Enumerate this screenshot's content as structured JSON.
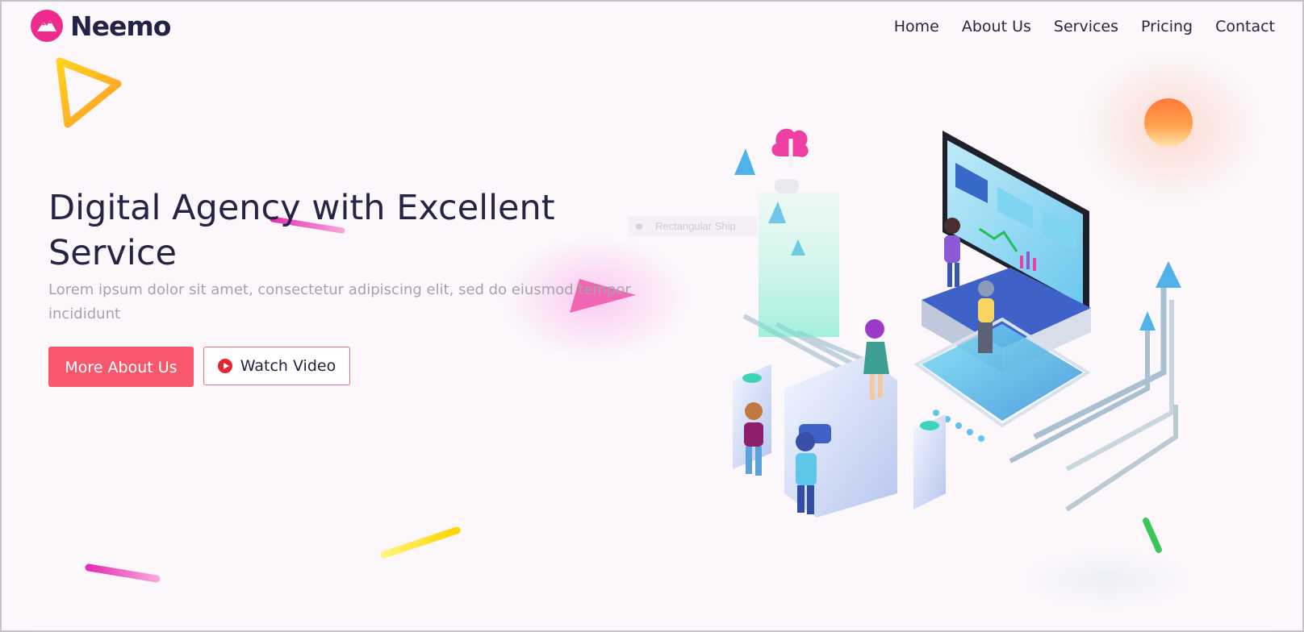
{
  "brand": {
    "name": "Neemo",
    "logo_icon": "mountain-icon",
    "accent": "#ef2b8e"
  },
  "nav": {
    "items": [
      "Home",
      "About Us",
      "Services",
      "Pricing",
      "Contact"
    ]
  },
  "hero": {
    "title": "Digital Agency with Excellent Service",
    "subtitle": "Lorem ipsum dolor sit amet, consectetur adipiscing elit, sed do eiusmod tempor incididunt",
    "primary_button": "More About Us",
    "secondary_button": "Watch Video",
    "secondary_icon": "play-icon",
    "primary_color": "#f7586c"
  },
  "overlay": {
    "tooltip_text": "Rectangular Ship"
  },
  "illustration": {
    "icon": "isometric-agency-illustration"
  }
}
